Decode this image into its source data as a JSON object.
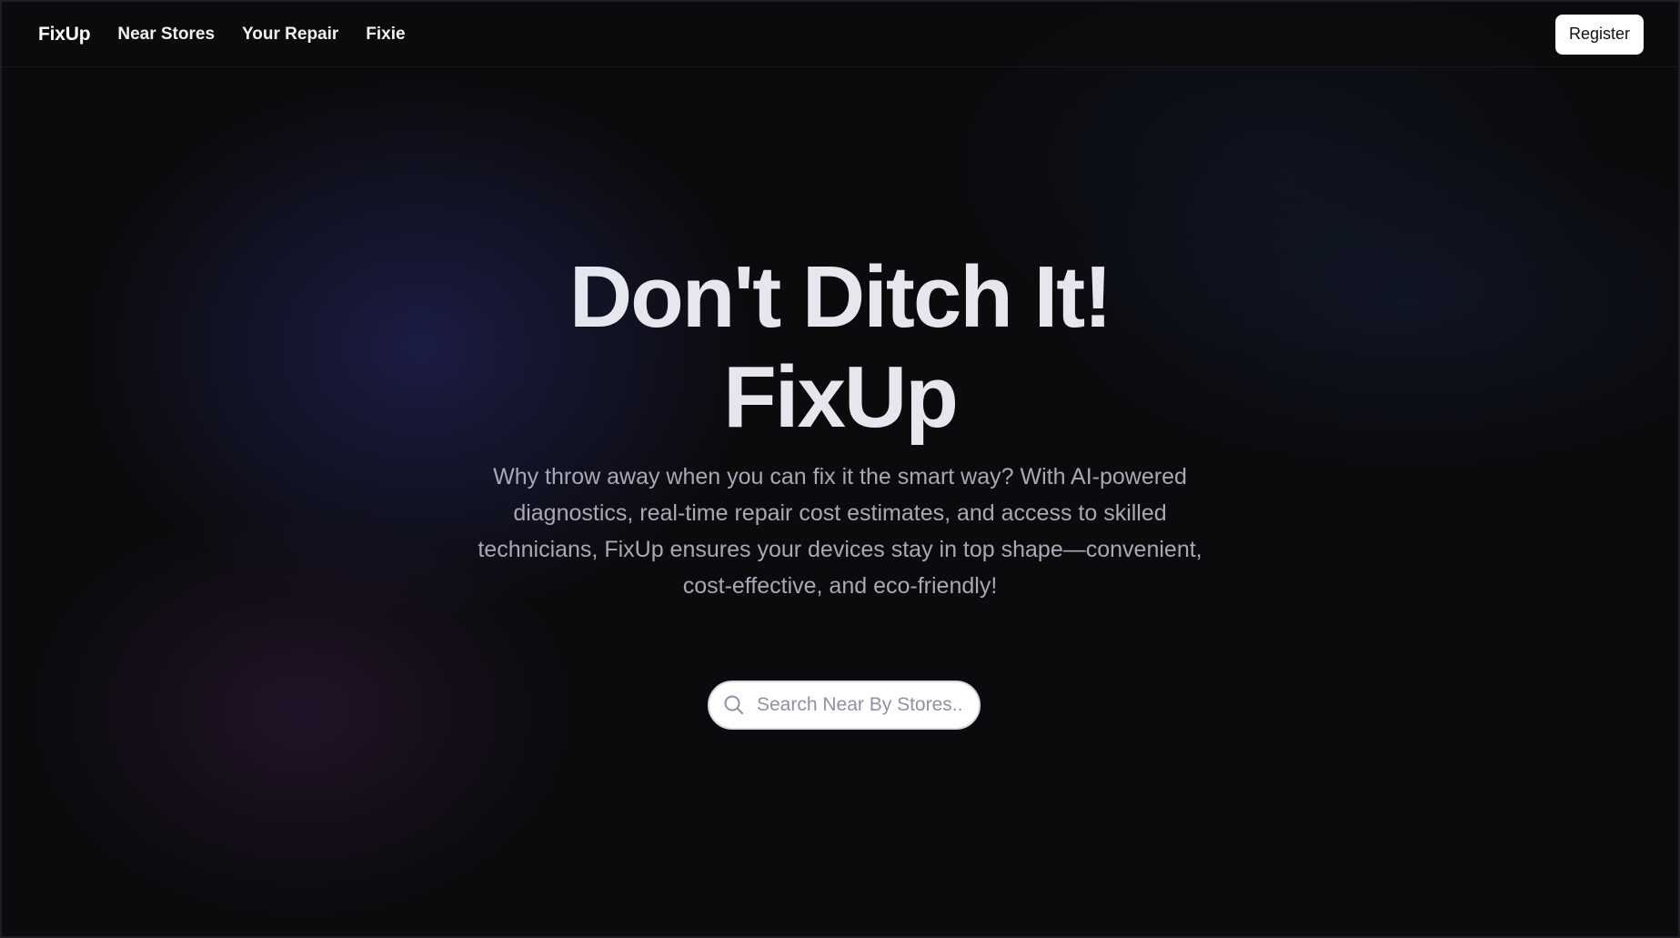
{
  "navbar": {
    "brand": "FixUp",
    "links": [
      {
        "label": "Near Stores"
      },
      {
        "label": "Your Repair"
      },
      {
        "label": "Fixie"
      }
    ],
    "register_label": "Register"
  },
  "hero": {
    "title_line1": "Don't Ditch It!",
    "title_line2": "FixUp",
    "subtitle": "Why throw away when you can fix it the smart way? With AI-powered diagnostics, real-time repair cost estimates, and access to skilled technicians, FixUp ensures your devices stay in top shape—convenient, cost-effective, and eco-friendly!"
  },
  "search": {
    "placeholder": "Search Near By Stores..",
    "value": "",
    "icon": "search-icon"
  },
  "colors": {
    "background": "#0b0b0e",
    "title": "#e6e6ee",
    "subtitle": "#a8a8b6",
    "button_bg": "#ffffff",
    "button_text": "#111114"
  }
}
